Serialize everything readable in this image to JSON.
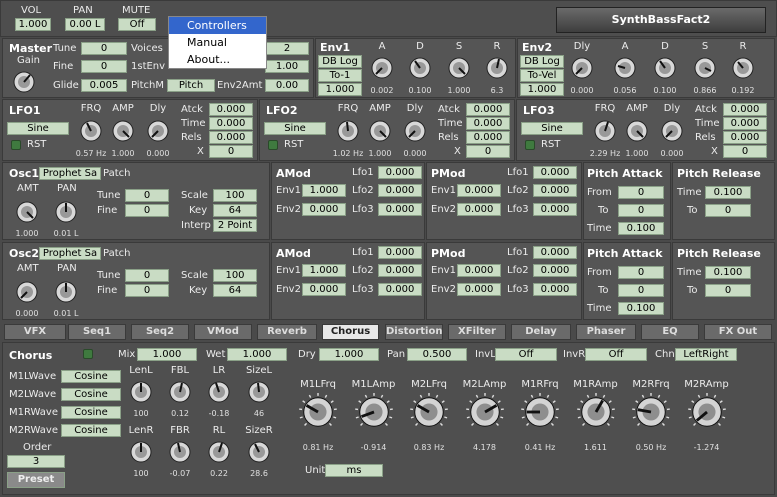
{
  "top": {
    "vol_label": "VOL",
    "vol_value": "1.000",
    "pan_label": "PAN",
    "pan_value": "0.00 L",
    "mute_label": "MUTE",
    "mute_value": "Off",
    "preset_name": "SynthBassFact2"
  },
  "menu": {
    "items": [
      "Controllers",
      "Manual",
      "About..."
    ]
  },
  "master": {
    "title": "Master",
    "gain_label": "Gain",
    "tune_label": "Tune",
    "tune": "0",
    "fine_label": "Fine",
    "fine": "0",
    "glide_label": "Glide",
    "glide": "0.005",
    "voices_label": "Voices",
    "voices": "2",
    "firstenv_label": "1stEnv",
    "firstenv": "1.00",
    "pitchm_label": "PitchM",
    "pitchm": "Pitch",
    "env2amt_label": "Env2Amt",
    "env2amt": "0.00"
  },
  "env1": {
    "title": "Env1",
    "mode": "DB Log",
    "trigger": "To-1",
    "amount": "1.000",
    "labels": [
      "A",
      "D",
      "S",
      "R"
    ],
    "values": [
      "0.002",
      "0.100",
      "1.000",
      "6.3"
    ]
  },
  "env2": {
    "title": "Env2",
    "mode": "DB Log",
    "trigger": "To-Vel",
    "amount": "1.000",
    "labels": [
      "Dly",
      "A",
      "D",
      "S",
      "R"
    ],
    "values": [
      "0.000",
      "0.056",
      "0.100",
      "0.866",
      "0.192"
    ]
  },
  "lfo1": {
    "title": "LFO1",
    "wave": "Sine",
    "rst": "RST",
    "knob_labels": [
      "FRQ",
      "AMP",
      "Dly"
    ],
    "knob_values": [
      "0.57 Hz",
      "1.000",
      "0.000"
    ],
    "atck_label": "Atck",
    "atck": "0.000",
    "time_label": "Time",
    "time": "0.000",
    "rels_label": "Rels",
    "rels": "0.000",
    "x_label": "X",
    "x": "0"
  },
  "lfo2": {
    "title": "LFO2",
    "wave": "Sine",
    "rst": "RST",
    "knob_labels": [
      "FRQ",
      "AMP",
      "Dly"
    ],
    "knob_values": [
      "1.02 Hz",
      "1.000",
      "0.000"
    ],
    "atck_label": "Atck",
    "atck": "0.000",
    "time_label": "Time",
    "time": "0.000",
    "rels_label": "Rels",
    "rels": "0.000",
    "x_label": "X",
    "x": "0"
  },
  "lfo3": {
    "title": "LFO3",
    "wave": "Sine",
    "rst": "RST",
    "knob_labels": [
      "FRQ",
      "AMP",
      "Dly"
    ],
    "knob_values": [
      "2.29 Hz",
      "1.000",
      "0.000"
    ],
    "atck_label": "Atck",
    "atck": "0.000",
    "time_label": "Time",
    "time": "0.000",
    "rels_label": "Rels",
    "rels": "0.000",
    "x_label": "X",
    "x": "0"
  },
  "osc1": {
    "title": "Osc1",
    "patch_name": "Prophet Sa",
    "patch_label": "Patch",
    "amt_label": "AMT",
    "pan_label": "PAN",
    "amt": "1.000",
    "pan": "0.01 L",
    "tune_label": "Tune",
    "tune": "0",
    "fine_label": "Fine",
    "fine": "0",
    "scale_label": "Scale",
    "scale": "100",
    "key_label": "Key",
    "key": "64",
    "interp_label": "Interp",
    "interp": "2 Point",
    "amod": {
      "title": "AMod",
      "env1_label": "Env1",
      "env1": "1.000",
      "env2_label": "Env2",
      "env2": "0.000",
      "lfo1_label": "Lfo1",
      "lfo1": "0.000",
      "lfo2_label": "Lfo2",
      "lfo2": "0.000",
      "lfo3_label": "Lfo3",
      "lfo3": "0.000"
    },
    "pmod": {
      "title": "PMod",
      "env1_label": "Env1",
      "env1": "0.000",
      "env2_label": "Env2",
      "env2": "0.000",
      "lfo1_label": "Lfo1",
      "lfo1": "0.000",
      "lfo2_label": "Lfo2",
      "lfo2": "0.000",
      "lfo3_label": "Lfo3",
      "lfo3": "0.000"
    },
    "pattack": {
      "title": "Pitch Attack",
      "from_label": "From",
      "from": "0",
      "to_label": "To",
      "to": "0",
      "time_label": "Time",
      "time": "0.100"
    },
    "prelease": {
      "title": "Pitch Release",
      "time_label": "Time",
      "time": "0.100",
      "to_label": "To",
      "to": "0"
    }
  },
  "osc2": {
    "title": "Osc2",
    "patch_name": "Prophet Sa",
    "patch_label": "Patch",
    "amt_label": "AMT",
    "pan_label": "PAN",
    "amt": "0.000",
    "pan": "0.01 L",
    "tune_label": "Tune",
    "tune": "0",
    "fine_label": "Fine",
    "fine": "0",
    "scale_label": "Scale",
    "scale": "100",
    "key_label": "Key",
    "key": "64",
    "amod": {
      "title": "AMod",
      "env1_label": "Env1",
      "env1": "1.000",
      "env2_label": "Env2",
      "env2": "0.000",
      "lfo1_label": "Lfo1",
      "lfo1": "0.000",
      "lfo2_label": "Lfo2",
      "lfo2": "0.000",
      "lfo3_label": "Lfo3",
      "lfo3": "0.000"
    },
    "pmod": {
      "title": "PMod",
      "env1_label": "Env1",
      "env1": "0.000",
      "env2_label": "Env2",
      "env2": "0.000",
      "lfo1_label": "Lfo1",
      "lfo1": "0.000",
      "lfo2_label": "Lfo2",
      "lfo2": "0.000",
      "lfo3_label": "Lfo3",
      "lfo3": "0.000"
    },
    "pattack": {
      "title": "Pitch Attack",
      "from_label": "From",
      "from": "0",
      "to_label": "To",
      "to": "0",
      "time_label": "Time",
      "time": "0.100"
    },
    "prelease": {
      "title": "Pitch Release",
      "time_label": "Time",
      "time": "0.100",
      "to_label": "To",
      "to": "0"
    }
  },
  "tabs": [
    "VFX",
    "Seq1",
    "Seq2",
    "VMod",
    "Reverb",
    "Chorus",
    "Distortion",
    "XFilter",
    "Delay",
    "Phaser",
    "EQ",
    "FX Out"
  ],
  "chorus": {
    "title": "Chorus",
    "mix_label": "Mix",
    "mix": "1.000",
    "wet_label": "Wet",
    "wet": "1.000",
    "dry_label": "Dry",
    "dry": "1.000",
    "pan_label": "Pan",
    "pan": "0.500",
    "invl_label": "InvL",
    "invl": "Off",
    "invr_label": "InvR",
    "invr": "Off",
    "chn_label": "Chn",
    "chn": "LeftRight",
    "waves": [
      {
        "label": "M1LWave",
        "value": "Cosine"
      },
      {
        "label": "M2LWave",
        "value": "Cosine"
      },
      {
        "label": "M1RWave",
        "value": "Cosine"
      },
      {
        "label": "M2RWave",
        "value": "Cosine"
      }
    ],
    "order_label": "Order",
    "order": "3",
    "preset_label": "Preset",
    "small_knobs_top": {
      "labels": [
        "LenL",
        "FBL",
        "LR",
        "SizeL"
      ],
      "values": [
        "100",
        "0.12",
        "-0.18",
        "46"
      ]
    },
    "small_knobs_bottom": {
      "labels": [
        "LenR",
        "FBR",
        "RL",
        "SizeR"
      ],
      "values": [
        "100",
        "-0.07",
        "0.22",
        "28.6"
      ]
    },
    "big_knobs": {
      "labels": [
        "M1LFrq",
        "M1LAmp",
        "M2LFrq",
        "M2LAmp",
        "M1RFrq",
        "M1RAmp",
        "M2RFrq",
        "M2RAmp"
      ],
      "values": [
        "0.81 Hz",
        "-0.914",
        "0.83 Hz",
        "4.178",
        "0.41 Hz",
        "1.611",
        "0.50 Hz",
        "-1.274"
      ]
    },
    "unit_label": "Unit",
    "unit": "ms"
  }
}
